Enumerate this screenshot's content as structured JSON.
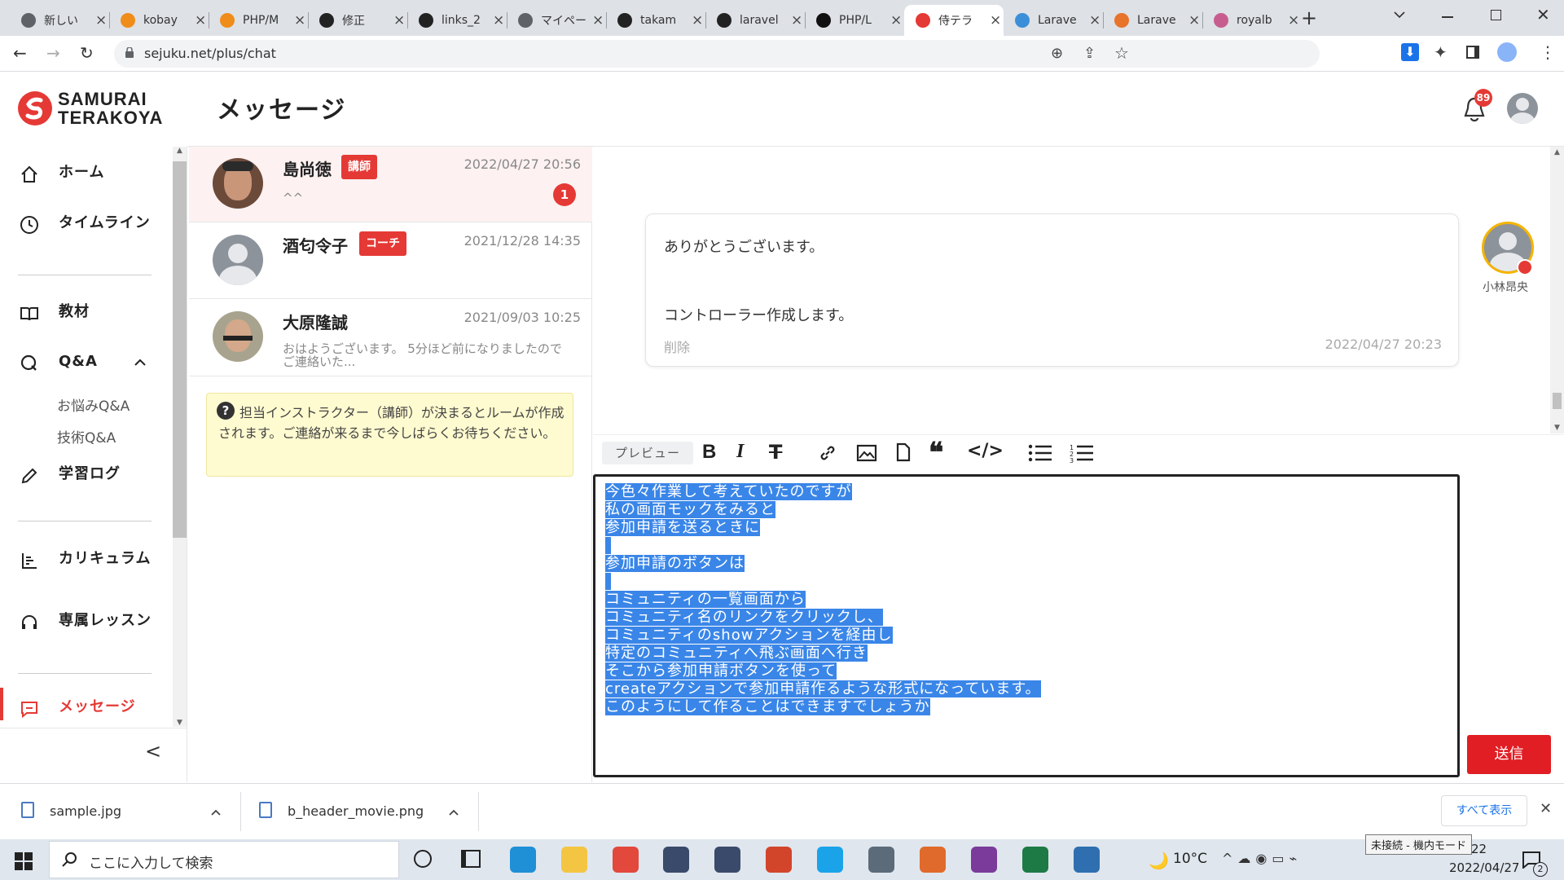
{
  "browser": {
    "tabs": [
      {
        "label": "新しい",
        "color": "#5f6368"
      },
      {
        "label": "kobay",
        "color": "#f08c1a"
      },
      {
        "label": "PHP/M",
        "color": "#f08c1a"
      },
      {
        "label": "修正",
        "color": "#222222"
      },
      {
        "label": "links_2",
        "color": "#222222"
      },
      {
        "label": "マイペー",
        "color": "#5f6368"
      },
      {
        "label": "takam",
        "color": "#222222"
      },
      {
        "label": "laravel",
        "color": "#222222"
      },
      {
        "label": "PHP/L",
        "color": "#111111"
      },
      {
        "label": "侍テラ",
        "color": "#e53935"
      },
      {
        "label": "Larave",
        "color": "#3b8fd9"
      },
      {
        "label": "Larave",
        "color": "#e8732a"
      },
      {
        "label": "royalb",
        "color": "#c75d8f"
      }
    ],
    "url": "sejuku.net/plus/chat"
  },
  "logo": {
    "line1": "SAMURAI",
    "line2": "TERAKOYA"
  },
  "header": {
    "title": "メッセージ",
    "notification_count": "89"
  },
  "sidebar": {
    "home": "ホーム",
    "timeline": "タイムライン",
    "materials": "教材",
    "qa": "Q&A",
    "qa_worries": "お悩みQ&A",
    "qa_tech": "技術Q&A",
    "study_log": "学習ログ",
    "curriculum": "カリキュラム",
    "lesson": "専属レッスン",
    "messages": "メッセージ",
    "collapse": "<"
  },
  "conversations": [
    {
      "name": "島尚徳",
      "role": "講師",
      "date": "2022/04/27 20:56",
      "preview": "^^",
      "unread": "1"
    },
    {
      "name": "酒匂令子",
      "role": "コーチ",
      "date": "2021/12/28 14:35",
      "preview": ""
    },
    {
      "name": "大原隆誠",
      "role": "",
      "date": "2021/09/03 10:25",
      "preview": "おはようございます。 5分ほど前になりましたのでご連絡いた..."
    }
  ],
  "notice": "担当インストラクター（講師）が決まるとルームが作成されます。ご連絡が来るまで今しばらくお待ちください。",
  "message": {
    "line1": "ありがとうございます。",
    "line2": "コントローラー作成します。",
    "delete": "削除",
    "date": "2022/04/27 20:23",
    "sender": "小林昂央"
  },
  "editor_toolbar": {
    "preview": "プレビュー"
  },
  "editor_lines": [
    "今色々作業して考えていたのですが",
    "私の画面モックをみると",
    "参加申請を送るときに",
    " ",
    "参加申請のボタンは",
    " ",
    "コミュニティの一覧画面から",
    "コミュニティ名のリンクをクリックし、",
    "コミュニティのshowアクションを経由し",
    "特定のコミュニティへ飛ぶ画面へ行き",
    "そこから参加申請ボタンを使って",
    "createアクションで参加申請作るような形式になっています。",
    "このようにして作ることはできますでしょうか"
  ],
  "send_button": "送信",
  "downloads": {
    "file1": "sample.jpg",
    "file2": "b_header_movie.png",
    "show_all": "すべて表示"
  },
  "taskbar": {
    "search_placeholder": "ここに入力して検索",
    "weather": "10°C",
    "tooltip": "未接続 - 機内モード",
    "time_partial": "22",
    "date": "2022/04/27",
    "notif_count": "2"
  },
  "colors": {
    "brand_red": "#e53935",
    "selection_blue": "#3a86e8"
  }
}
